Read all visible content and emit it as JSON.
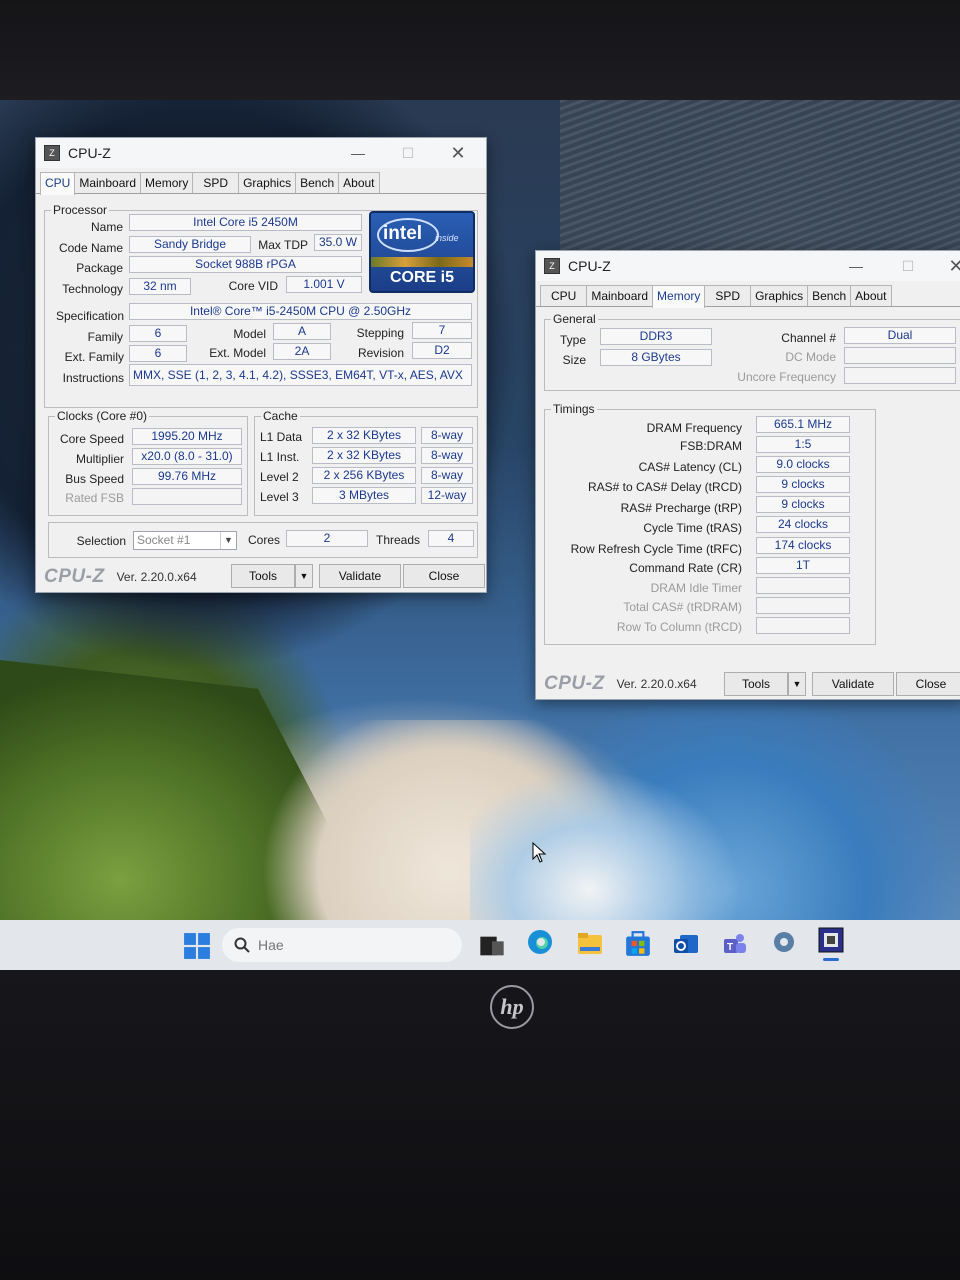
{
  "desktop": {
    "taskbar": {
      "search_placeholder": "Hae",
      "icons": [
        "windows-start-icon",
        "search-icon",
        "task-view-icon",
        "edge-icon",
        "file-explorer-icon",
        "store-icon",
        "outlook-icon",
        "teams-icon",
        "settings-icon",
        "cpuz-icon"
      ]
    },
    "laptop_logo": "hp"
  },
  "win1": {
    "title": "CPU-Z",
    "tabs": [
      "CPU",
      "Mainboard",
      "Memory",
      "SPD",
      "Graphics",
      "Bench",
      "About"
    ],
    "active_tab": "CPU",
    "processor": {
      "title": "Processor",
      "name_label": "Name",
      "name": "Intel Core i5 2450M",
      "codename_label": "Code Name",
      "codename": "Sandy Bridge",
      "maxtdp_label": "Max TDP",
      "maxtdp": "35.0 W",
      "package_label": "Package",
      "package": "Socket 988B rPGA",
      "technology_label": "Technology",
      "technology": "32 nm",
      "corevid_label": "Core VID",
      "corevid": "1.001 V",
      "spec_label": "Specification",
      "spec": "Intel® Core™ i5-2450M CPU @ 2.50GHz",
      "family_label": "Family",
      "family": "6",
      "model_label": "Model",
      "model": "A",
      "stepping_label": "Stepping",
      "stepping": "7",
      "extfamily_label": "Ext. Family",
      "extfamily": "6",
      "extmodel_label": "Ext. Model",
      "extmodel": "2A",
      "revision_label": "Revision",
      "revision": "D2",
      "instructions_label": "Instructions",
      "instructions": "MMX, SSE (1, 2, 3, 4.1, 4.2), SSSE3, EM64T, VT-x, AES, AVX"
    },
    "intel_badge": {
      "word": "intel",
      "inside": "inside",
      "core": "CORE i5"
    },
    "clocks": {
      "title": "Clocks (Core #0)",
      "corespeed_label": "Core Speed",
      "corespeed": "1995.20 MHz",
      "multiplier_label": "Multiplier",
      "multiplier": "x20.0 (8.0 - 31.0)",
      "busspeed_label": "Bus Speed",
      "busspeed": "99.76 MHz",
      "ratedfsb_label": "Rated FSB",
      "ratedfsb": ""
    },
    "cache": {
      "title": "Cache",
      "rows": [
        {
          "label": "L1 Data",
          "size": "2 x 32 KBytes",
          "way": "8-way"
        },
        {
          "label": "L1 Inst.",
          "size": "2 x 32 KBytes",
          "way": "8-way"
        },
        {
          "label": "Level 2",
          "size": "2 x 256 KBytes",
          "way": "8-way"
        },
        {
          "label": "Level 3",
          "size": "3 MBytes",
          "way": "12-way"
        }
      ]
    },
    "selection_label": "Selection",
    "selection": "Socket #1",
    "cores_label": "Cores",
    "cores": "2",
    "threads_label": "Threads",
    "threads": "4",
    "brand": "CPU-Z",
    "version": "Ver. 2.20.0.x64",
    "tools": "Tools",
    "validate": "Validate",
    "close": "Close"
  },
  "win2": {
    "title": "CPU-Z",
    "tabs": [
      "CPU",
      "Mainboard",
      "Memory",
      "SPD",
      "Graphics",
      "Bench",
      "About"
    ],
    "active_tab": "Memory",
    "general": {
      "title": "General",
      "type_label": "Type",
      "type": "DDR3",
      "size_label": "Size",
      "size": "8 GBytes",
      "channel_label": "Channel #",
      "channel": "Dual",
      "dcmode_label": "DC Mode",
      "dcmode": "",
      "uncore_label": "Uncore Frequency",
      "uncore": ""
    },
    "timings": {
      "title": "Timings",
      "rows": [
        {
          "label": "DRAM Frequency",
          "value": "665.1 MHz",
          "dim": false
        },
        {
          "label": "FSB:DRAM",
          "value": "1:5",
          "dim": false
        },
        {
          "label": "CAS# Latency (CL)",
          "value": "9.0 clocks",
          "dim": false
        },
        {
          "label": "RAS# to CAS# Delay (tRCD)",
          "value": "9 clocks",
          "dim": false
        },
        {
          "label": "RAS# Precharge (tRP)",
          "value": "9 clocks",
          "dim": false
        },
        {
          "label": "Cycle Time (tRAS)",
          "value": "24 clocks",
          "dim": false
        },
        {
          "label": "Row Refresh Cycle Time (tRFC)",
          "value": "174 clocks",
          "dim": false
        },
        {
          "label": "Command Rate (CR)",
          "value": "1T",
          "dim": false
        },
        {
          "label": "DRAM Idle Timer",
          "value": "",
          "dim": true
        },
        {
          "label": "Total CAS# (tRDRAM)",
          "value": "",
          "dim": true
        },
        {
          "label": "Row To Column (tRCD)",
          "value": "",
          "dim": true
        }
      ]
    },
    "brand": "CPU-Z",
    "version": "Ver. 2.20.0.x64",
    "tools": "Tools",
    "validate": "Validate",
    "close": "Close"
  }
}
